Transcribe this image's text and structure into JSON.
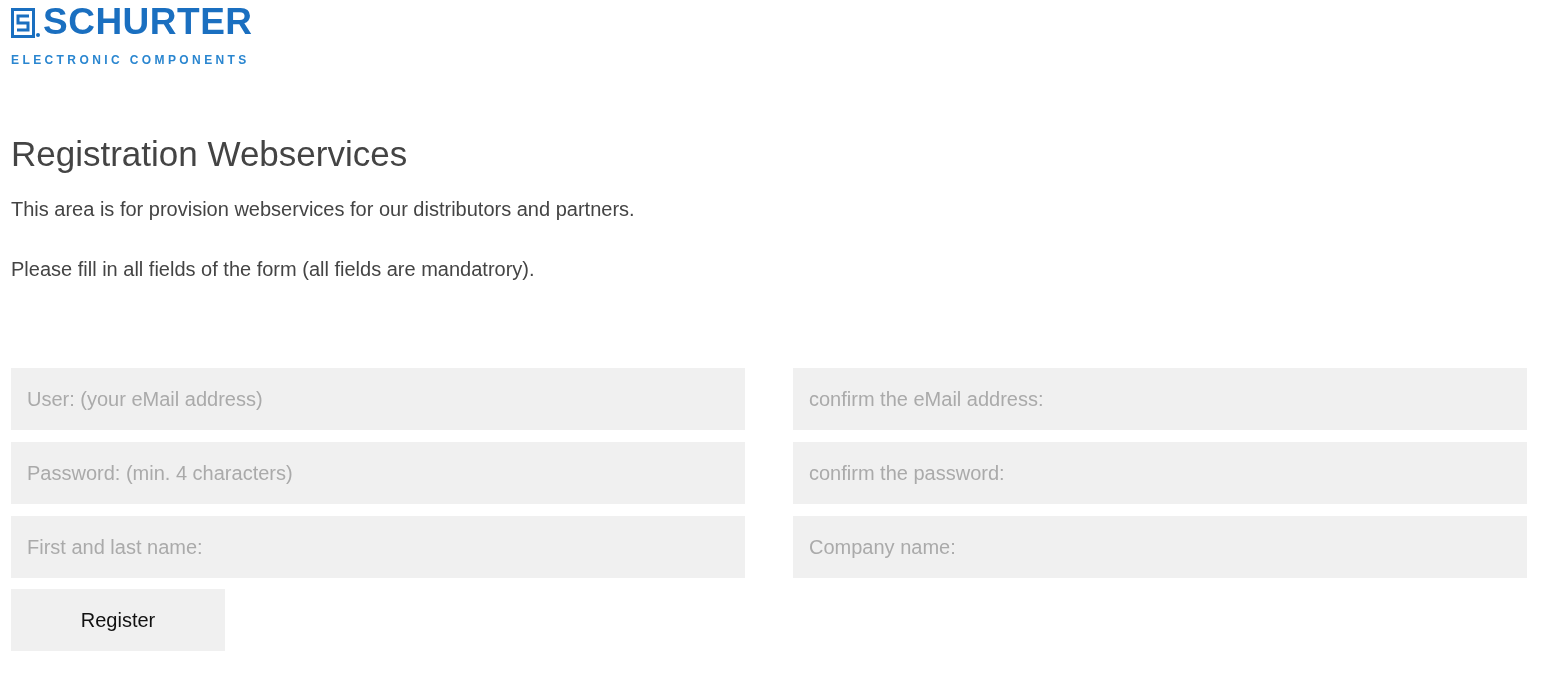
{
  "logo": {
    "name": "SCHURTER",
    "tagline": "ELECTRONIC COMPONENTS"
  },
  "title": "Registration Webservices",
  "paragraphs": [
    "This area is for provision webservices for our distributors and partners.",
    "Please fill in all fields of the form (all fields are mandatrory)."
  ],
  "fields": [
    {
      "placeholder": "User: (your eMail address)"
    },
    {
      "placeholder": "confirm the eMail address:"
    },
    {
      "placeholder": "Password: (min. 4 characters)"
    },
    {
      "placeholder": "confirm the password:"
    },
    {
      "placeholder": "First and last name:"
    },
    {
      "placeholder": "Company name:"
    }
  ],
  "button": "Register"
}
